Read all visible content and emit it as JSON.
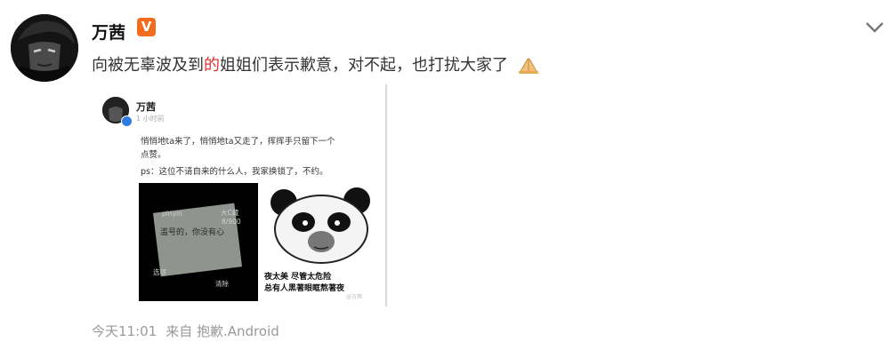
{
  "post": {
    "author": "万茜",
    "verified_badge": "V",
    "text_before": "向被无辜波及到",
    "text_highlight": "的",
    "text_after": "姐姐们表示歉意，对不起，也打扰大家了",
    "timestamp": "今天11:01",
    "source": "来自 抱歉.Android"
  },
  "embedded_screenshot": {
    "author": "万茜",
    "time": "1 小时前",
    "line1": "悄悄地ta来了，悄悄地ta又走了，挥挥手只留下一个",
    "line2": "点赞。",
    "line3": "ps：这位不请自来的什么人，我家换锁了，不约。",
    "left_panel": {
      "brand": "pinyin",
      "corner": "大C藏",
      "counter": "8/900",
      "message": "滥号的，你没有心",
      "bottom_left": "选项",
      "bottom_right": "清除"
    },
    "right_panel": {
      "caption_line1": "夜太美 尽管太危险",
      "caption_line2": "总有人黑著眼眶熬著夜",
      "watermark": "@万茜"
    }
  },
  "colors": {
    "highlight": "#e0322c",
    "badge": "#f36b1c",
    "meta": "#999999"
  }
}
